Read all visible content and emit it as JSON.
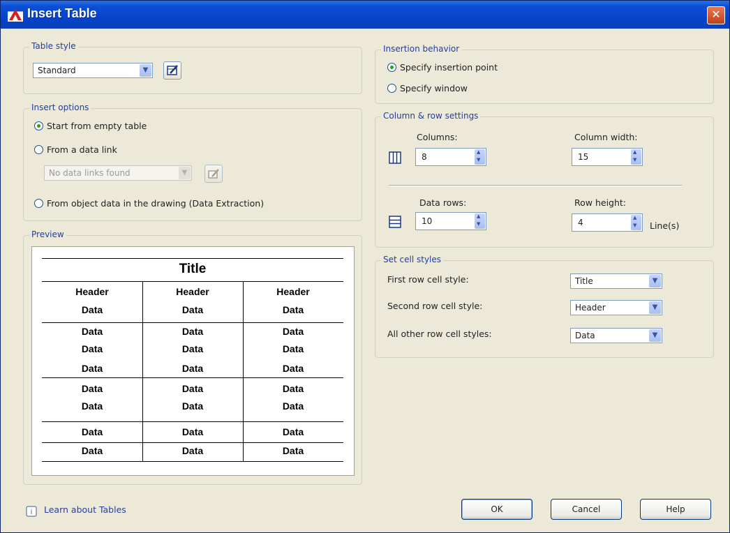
{
  "window": {
    "title": "Insert Table",
    "close_label": "✕"
  },
  "table_style": {
    "legend": "Table style",
    "value": "Standard"
  },
  "insert_options": {
    "legend": "Insert options",
    "opt_empty": "Start from empty table",
    "opt_datalink": "From a data link",
    "datalink_value": "No data links found",
    "opt_object": "From object data in the drawing (Data Extraction)",
    "selected": "empty"
  },
  "preview": {
    "legend": "Preview",
    "title": "Title",
    "headers": [
      "Header",
      "Header",
      "Header"
    ],
    "data_label": "Data"
  },
  "insertion_behavior": {
    "legend": "Insertion behavior",
    "opt_point": "Specify insertion point",
    "opt_window": "Specify window",
    "selected": "point"
  },
  "col_row": {
    "legend": "Column & row settings",
    "columns_label": "Columns:",
    "columns_value": "8",
    "col_width_label": "Column width:",
    "col_width_value": "15",
    "data_rows_label": "Data rows:",
    "data_rows_value": "10",
    "row_height_label": "Row height:",
    "row_height_value": "4",
    "row_height_unit": "Line(s)"
  },
  "cell_styles": {
    "legend": "Set cell styles",
    "first_label": "First row cell style:",
    "first_value": "Title",
    "second_label": "Second row cell style:",
    "second_value": "Header",
    "other_label": "All other row cell styles:",
    "other_value": "Data"
  },
  "footer": {
    "learn_link": "Learn about Tables",
    "ok": "OK",
    "cancel": "Cancel",
    "help": "Help"
  }
}
